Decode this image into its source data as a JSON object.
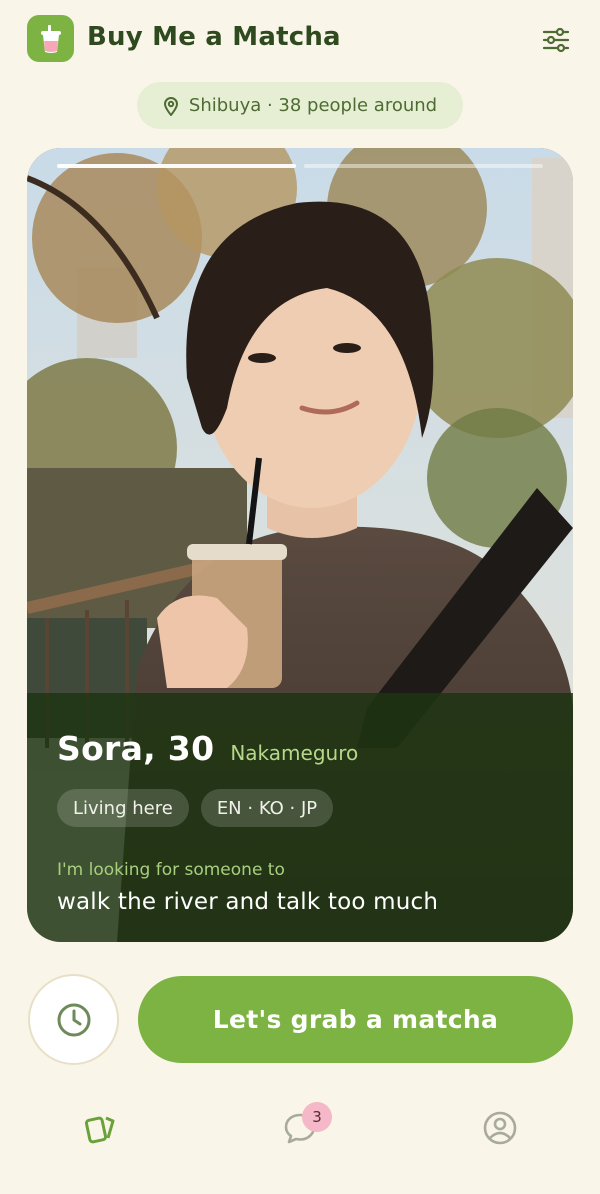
{
  "app": {
    "title": "Buy Me a Matcha",
    "logo_icon": "matcha-cup-icon",
    "filter_icon": "sliders-icon"
  },
  "location": {
    "icon": "map-pin-icon",
    "text": "Shibuya · 38 people around"
  },
  "profile": {
    "name_age": "Sora, 30",
    "neighborhood": "Nakameguro",
    "tags": [
      "Living here",
      "EN · KO · JP"
    ],
    "looking_label": "I'm looking for someone to",
    "looking_text": "walk the river and talk too much",
    "photo_count": 2,
    "active_photo": 1
  },
  "actions": {
    "later_icon": "clock-icon",
    "primary_label": "Let's grab a matcha"
  },
  "nav": {
    "discover_icon": "cards-icon",
    "chats_icon": "chat-bubble-icon",
    "chats_badge": "3",
    "profile_icon": "user-circle-icon"
  },
  "colors": {
    "background": "#faf5e9",
    "accent": "#7cb342",
    "dark_green": "#2f4a1f",
    "badge": "#f4b8c8"
  }
}
